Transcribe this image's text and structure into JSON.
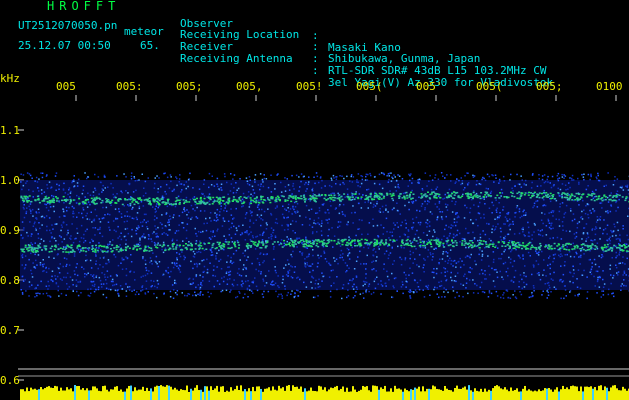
{
  "header": {
    "title": "HROFFT",
    "file_name": "UT2512070050.pn",
    "meteor_label": "meteor",
    "timestamp": "25.12.07 00:50",
    "count": "65."
  },
  "info": [
    {
      "label": "Observer",
      "value": "Masaki Kano"
    },
    {
      "label": "Receiving Location",
      "value": "Shibukawa, Gunma, Japan"
    },
    {
      "label": "Receiver",
      "value": "RTL-SDR SDR# 43dB L15 103.2MHz CW"
    },
    {
      "label": "Receiving Antenna",
      "value": "3el Yagi(V) Az 330 for Vladivostok"
    }
  ],
  "axis": {
    "unit": "kHz",
    "y_ticks": [
      "1.1",
      "1.0",
      "0.9",
      "0.8",
      "0.7",
      "0.6"
    ],
    "x_ticks": [
      "005",
      "0052",
      "0053",
      "0054",
      "0055",
      "0056",
      "0057",
      "0058",
      "0059",
      "0100"
    ],
    "x_tick_display": [
      "005",
      "005:",
      "005;",
      "005,",
      "005!",
      "005(",
      "005'",
      "005(",
      "005;",
      "0100"
    ]
  },
  "colors": {
    "background": "#000000",
    "title": "#00ff44",
    "info_text": "#00e6e6",
    "axis_labels": "#f0f000",
    "axis_lines": "#cfcfcf",
    "echo_band": "#1a3cff",
    "echo_core": "#20e060",
    "noise_bar": "#f0f000"
  },
  "signal": {
    "band_top_khz": 1.0,
    "band_bottom_khz": 0.78,
    "trace_upper_khz": 0.965,
    "trace_lower_khz": 0.87
  }
}
